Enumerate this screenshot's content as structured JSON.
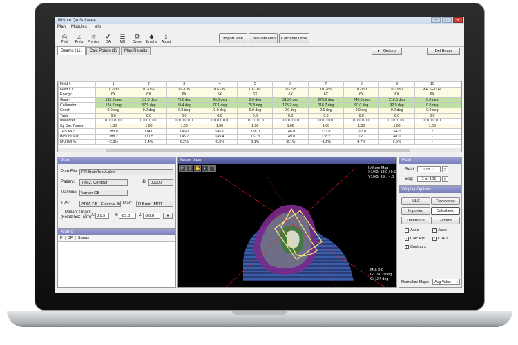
{
  "window": {
    "title": "IMSure QA Software"
  },
  "menu": [
    "Plan",
    "Modules",
    "Help"
  ],
  "toolbar": {
    "tools": [
      {
        "label": "Print",
        "icon": "printer-icon",
        "glyph": "⎙"
      },
      {
        "label": "Prefs",
        "icon": "prefs-icon",
        "glyph": "☑"
      },
      {
        "label": "Physics",
        "icon": "physics-icon",
        "glyph": "⚛"
      },
      {
        "label": "QA",
        "icon": "qa-icon",
        "glyph": "✔"
      },
      {
        "label": "MU",
        "icon": "mu-icon",
        "glyph": "☰"
      },
      {
        "label": "Cyber",
        "icon": "cyber-icon",
        "glyph": "⚙"
      },
      {
        "label": "Brachy",
        "icon": "brachy-icon",
        "glyph": "◆"
      },
      {
        "label": "About",
        "icon": "about-icon",
        "glyph": "ℹ"
      }
    ],
    "import_plan": "Import Plan",
    "calculate_map": "Calculate Map",
    "calculate_dose": "Calculate Dose"
  },
  "tabs": [
    "Beams (11)",
    "Calc Points (1)",
    "Map Results"
  ],
  "options_label": "Options",
  "del_beam_label": "Del Beam",
  "beams": {
    "headers": [
      "1",
      "2",
      "3",
      "4",
      "5",
      "6",
      "7",
      "8",
      "9",
      "10"
    ],
    "rows": [
      {
        "label": "Field #",
        "cls": "w",
        "cells": [
          "1",
          "2",
          "3",
          "4",
          "5",
          "6",
          "7",
          "8",
          "9",
          "10"
        ]
      },
      {
        "label": "Field ID",
        "cls": "y",
        "cells": [
          "01-030",
          "01-065",
          "01-105",
          "01-135",
          "01-180",
          "01-225",
          "01-265",
          "01-300",
          "01-330",
          "AP SETUP"
        ]
      },
      {
        "label": "Energy",
        "cls": "y",
        "cells": [
          "6X",
          "6X",
          "6X",
          "6X",
          "6X",
          "6X",
          "6X",
          "6X",
          "6X",
          "6X"
        ]
      },
      {
        "label": "Gantry",
        "cls": "g",
        "cells": [
          "150.0 deg",
          "115.0 deg",
          "75.0 deg",
          "45.0 deg",
          "0.0 deg",
          "315.0 deg",
          "275.0 deg",
          "240.0 deg",
          "210.0 deg",
          "0.0 deg"
        ]
      },
      {
        "label": "Collimator",
        "cls": "g",
        "cells": [
          "124.7 deg",
          "57.9 deg",
          "59.4 deg",
          "77.1 deg",
          "75.5 deg",
          "125.7 deg",
          "116.7 deg",
          "90.0 deg",
          "92.9 deg",
          "0.0 deg"
        ]
      },
      {
        "label": "Couch",
        "cls": "y",
        "cells": [
          "0.0 deg",
          "0.0 deg",
          "0.0 deg",
          "0.0 deg",
          "0.0 deg",
          "0.0 deg",
          "0.0 deg",
          "0.0 deg",
          "0.0 deg",
          "0.0 deg"
        ]
      },
      {
        "label": "Table",
        "cls": "y",
        "cells": [
          "0.0",
          "0.0",
          "0.0",
          "0.0",
          "0.0",
          "0.0",
          "0.0",
          "0.0",
          "0.0",
          "0.0"
        ]
      },
      {
        "label": "Isocenter",
        "cls": "w",
        "cells": [
          "0.0 0.0 0.0",
          "0.0 0.0 0.0",
          "0.0 0.0 0.0",
          "0.0 0.0 0.0",
          "0.0 0.0 0.0",
          "0.0 0.0 0.0",
          "0.0 0.0 0.0",
          "0.0 0.0 0.0",
          "0.0 0.0 0.0",
          "0.0 0.0 0.0"
        ]
      },
      {
        "label": "Sp Cor. Factor",
        "cls": "y",
        "cells": [
          "1.00",
          "1.00",
          "1.00",
          "1.00",
          "1.00",
          "1.00",
          "1.00",
          "1.00",
          "1.00",
          "1.00"
        ]
      },
      {
        "label": "TPS MU:",
        "cls": "w",
        "cells": [
          "183.0",
          "174.0",
          "146.0",
          "145.0",
          "158.0",
          "146.0",
          "137.0",
          "107.0",
          "54.0",
          "2"
        ]
      },
      {
        "label": "IMSure MU:",
        "cls": "w",
        "cells": [
          "188.2",
          "171.5",
          "145.7",
          "145.4",
          "157.8",
          "149.0",
          "138.7",
          "112.1",
          "48.0",
          "-"
        ]
      },
      {
        "label": "MU Diff %:",
        "cls": "w",
        "cells": [
          "-2.8%",
          "1.4%",
          "0.2%",
          "-0.3%",
          "0.1%",
          "-2.1%",
          "-1.2%",
          "4.7%",
          "9.5%",
          "-"
        ]
      }
    ]
  },
  "plan": {
    "title": "Plan",
    "plan_file_label": "Plan File:",
    "plan_file": "RP.BrainTestA.dcm",
    "patient_label": "Patient:",
    "patient": "Test2, Contour",
    "id_label": "ID:",
    "id": "00000",
    "machine_label": "Machine:",
    "machine": "Varian GB",
    "tps_label": "TPS:",
    "tps": "ARIA 7.5 - External Beam",
    "plan_label": "Plan:",
    "plan_name": "R Brain IMRT",
    "origin_label1": "Patient Origin:",
    "origin_label2": "(Fixed IEC) (cm)",
    "x_label": "X:",
    "x": "21.9",
    "y_label": "Y:",
    "y": "-85.8",
    "z_label": "Z:",
    "z": "-20.8"
  },
  "status": {
    "title": "Status",
    "cols": [
      "F",
      "CP",
      "Status"
    ]
  },
  "beam_view": {
    "title": "Beam View",
    "map_name": "IMSure Map",
    "coords1": "X1/X2: 13.0 / 9.5",
    "coords2": "Y1/Y2: 8.8 / 4.0",
    "mu": "MU: 0.0",
    "gantry": "G: 150.0 deg",
    "collimator": "C: 124 deg",
    "accent_red": "#e0202a",
    "beam_yellow": "#f3e27a"
  },
  "field": {
    "title": "Field",
    "field_label": "Field:",
    "field_value": "1 of 11",
    "seg_label": "Seg:",
    "seg_value": "1 of 191"
  },
  "display": {
    "title": "Display Options",
    "buttons": [
      "MLC",
      "Transverse",
      "Imported",
      "Calculated",
      "Difference",
      "Gamma"
    ],
    "checks": [
      {
        "label": "Axes",
        "checked": true
      },
      {
        "label": "Jaws",
        "checked": true
      },
      {
        "label": "Calc Pts",
        "checked": true
      },
      {
        "label": "CIAO",
        "checked": true
      },
      {
        "label": "Contours",
        "checked": true
      }
    ],
    "normalize_label": "Normalize Maps:",
    "normalize_value": "Avg Value"
  }
}
